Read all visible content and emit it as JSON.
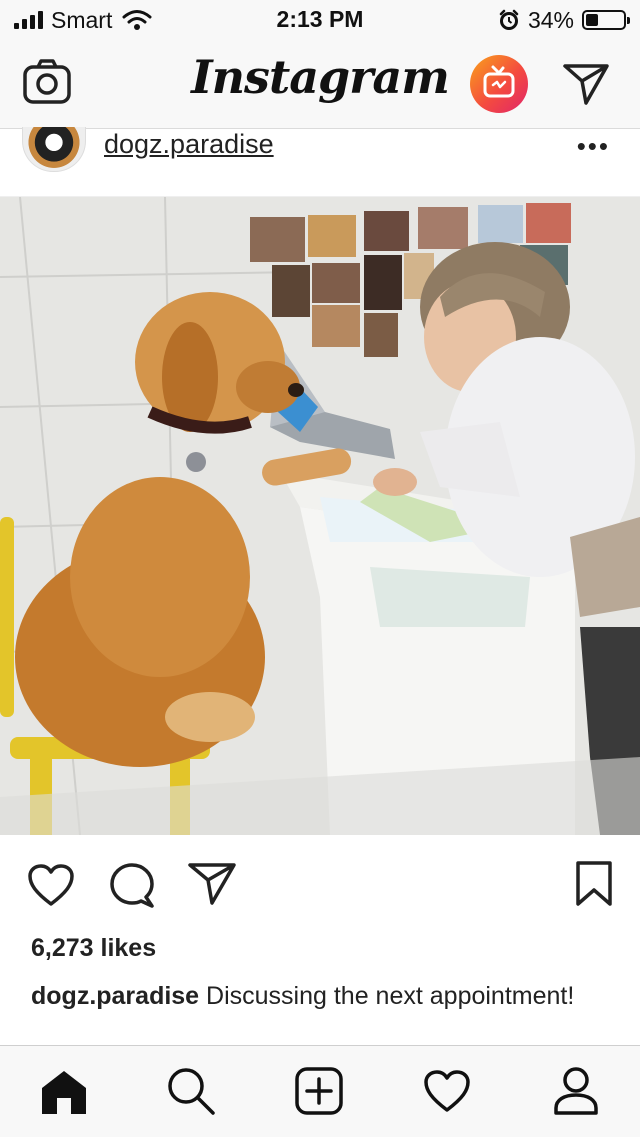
{
  "status_bar": {
    "carrier": "Smart",
    "time": "2:13 PM",
    "battery_percent_label": "34%",
    "battery_level": 0.34
  },
  "nav": {
    "title": "Instagram",
    "icons": [
      "camera-icon",
      "igtv-icon",
      "direct-message-icon"
    ],
    "igtv_gradient": [
      "#f9a21b",
      "#f44b3f",
      "#e0256a"
    ]
  },
  "post": {
    "username": "dogz.paradise",
    "likes": "6,273 likes",
    "caption_user": "dogz.paradise",
    "caption_text": " Discussing the next appointment!"
  },
  "tab_bar": {
    "items": [
      "home-icon",
      "search-icon",
      "new-post-icon",
      "activity-icon",
      "profile-icon"
    ]
  }
}
